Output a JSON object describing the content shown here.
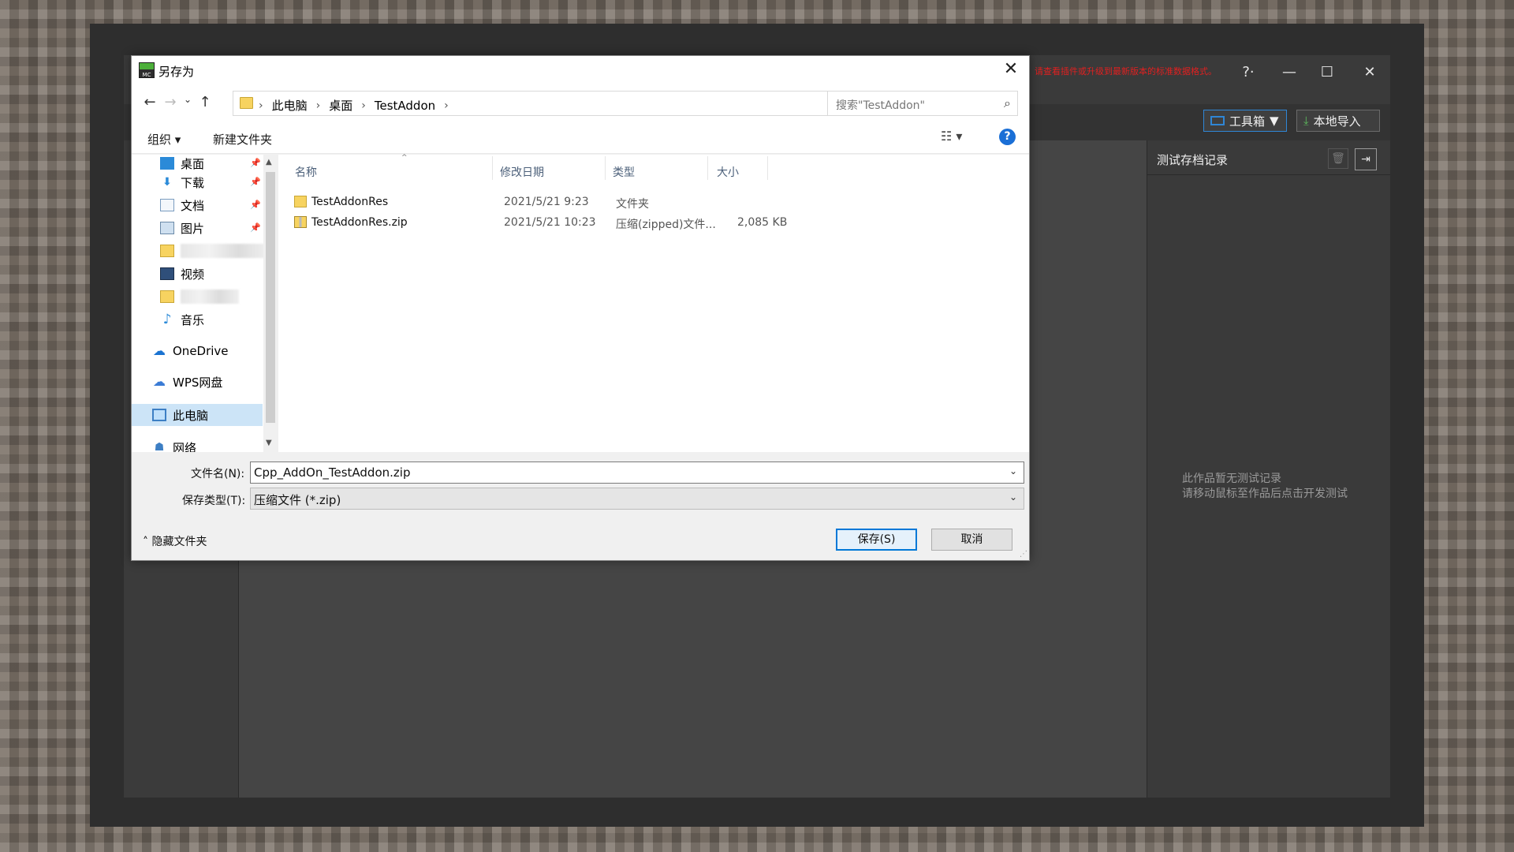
{
  "launcher": {
    "warning_text": "请查看插件或升级到最新版本的标准数据格式。",
    "window_buttons": {
      "help": "?·",
      "minimize": "—",
      "maximize": "☐",
      "close": "✕"
    },
    "toolbar": {
      "toolbox_label": "工具箱",
      "import_label": "本地导入"
    },
    "record_panel": {
      "title": "测试存档记录",
      "empty_line1": "此作品暂无测试记录",
      "empty_line2": "请移动鼠标至作品后点击开发测试"
    }
  },
  "dialog": {
    "title": "另存为",
    "close_glyph": "✕",
    "nav": {
      "back": "←",
      "forward": "→",
      "recent": "⌄",
      "up": "↑"
    },
    "breadcrumb": [
      "此电脑",
      "桌面",
      "TestAddon"
    ],
    "search_placeholder": "搜索\"TestAddon\"",
    "commands": {
      "organize": "组织 ▾",
      "new_folder": "新建文件夹",
      "view": "☷ ▾",
      "help": "?"
    },
    "nav_pane": {
      "items": [
        {
          "label": "桌面",
          "icon": "desktop-icon",
          "pinned": true
        },
        {
          "label": "下载",
          "icon": "download-icon",
          "pinned": true
        },
        {
          "label": "文档",
          "icon": "document-icon",
          "pinned": true
        },
        {
          "label": "图片",
          "icon": "pictures-icon",
          "pinned": true
        },
        {
          "label": "视频",
          "icon": "video-icon",
          "pinned": false
        },
        {
          "label": "音乐",
          "icon": "music-icon",
          "pinned": false
        },
        {
          "label": "OneDrive",
          "icon": "onedrive-icon",
          "pinned": false
        },
        {
          "label": "WPS网盘",
          "icon": "wps-cloud-icon",
          "pinned": false
        },
        {
          "label": "此电脑",
          "icon": "computer-icon",
          "pinned": false
        },
        {
          "label": "网络",
          "icon": "network-icon",
          "pinned": false
        }
      ]
    },
    "columns": {
      "name": "名称",
      "modified": "修改日期",
      "type": "类型",
      "size": "大小"
    },
    "files": [
      {
        "name": "TestAddonRes",
        "modified": "2021/5/21 9:23",
        "type": "文件夹",
        "size": ""
      },
      {
        "name": "TestAddonRes.zip",
        "modified": "2021/5/21 10:23",
        "type": "压缩(zipped)文件...",
        "size": "2,085 KB"
      }
    ],
    "form": {
      "filename_label": "文件名(N):",
      "filename_value": "Cpp_AddOn_TestAddon.zip",
      "filetype_label": "保存类型(T):",
      "filetype_value": "压缩文件 (*.zip)"
    },
    "hide_folders": "隐藏文件夹",
    "buttons": {
      "save": "保存(S)",
      "cancel": "取消"
    }
  }
}
